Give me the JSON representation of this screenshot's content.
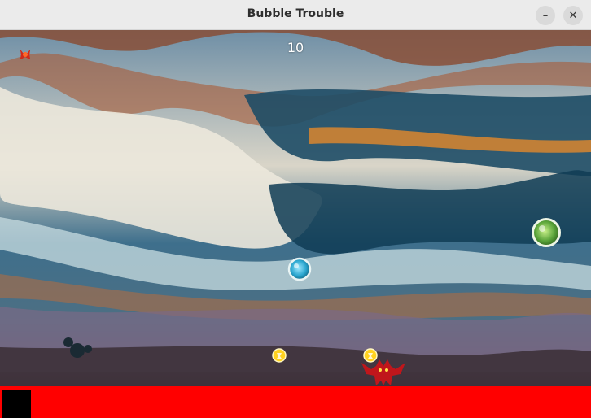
{
  "window": {
    "title": "Bubble Trouble"
  },
  "hud": {
    "score": "10",
    "lives": 3
  },
  "icons": {
    "minimize": "minimize-icon",
    "close": "close-icon",
    "life": "devil-life-icon",
    "player": "devil-player-icon",
    "bubble": "bubble-icon",
    "powerup": "coin-powerup-icon"
  },
  "colors": {
    "floor": "#ff0000",
    "titlebar": "#ebebeb",
    "bubble_cyan": "#3fb8d6",
    "bubble_green": "#6ab04c",
    "powerup": "#ffd21f",
    "player": "#c0161b"
  }
}
